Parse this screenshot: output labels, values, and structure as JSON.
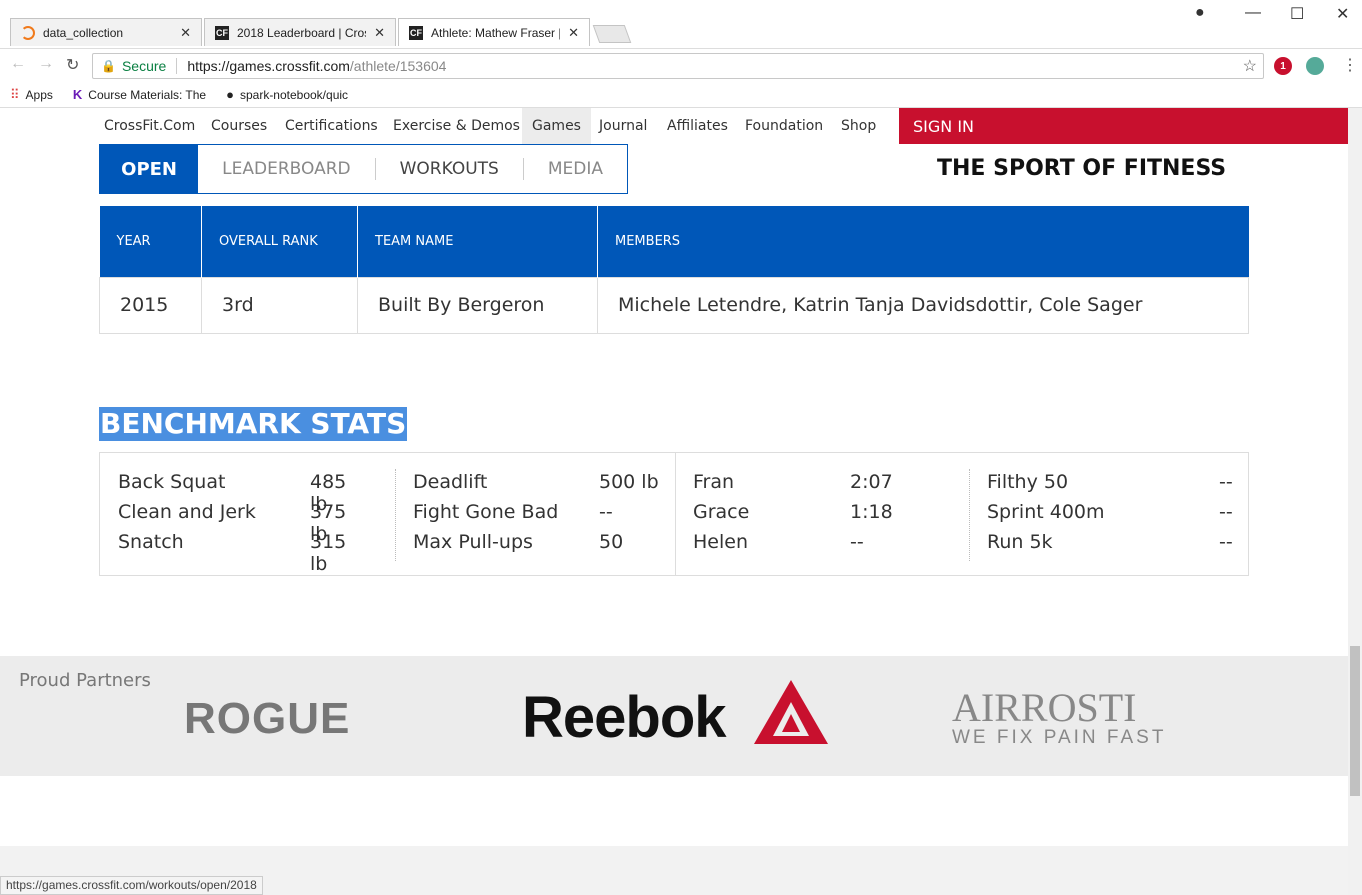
{
  "browser": {
    "tabs": [
      {
        "title": "data_collection",
        "icon": "ring-icon"
      },
      {
        "title": "2018 Leaderboard | Cros",
        "icon": "cf-icon"
      },
      {
        "title": "Athlete: Mathew Fraser |",
        "icon": "cf-icon"
      }
    ],
    "secure_label": "Secure",
    "url_host": "https://games.crossfit.com",
    "url_path": "/athlete/153604",
    "bookmarks": [
      {
        "label": "Apps"
      },
      {
        "label": "Course Materials: The"
      },
      {
        "label": "spark-notebook/quic"
      }
    ],
    "ext_badge": "1",
    "status_url": "https://games.crossfit.com/workouts/open/2018"
  },
  "site_nav": {
    "items": [
      "CrossFit.Com",
      "Courses",
      "Certifications",
      "Exercise & Demos",
      "Games",
      "Journal",
      "Affiliates",
      "Foundation",
      "Shop"
    ],
    "signin": "SIGN IN"
  },
  "sub_nav": {
    "open": "OPEN",
    "items": [
      "LEADERBOARD",
      "WORKOUTS",
      "MEDIA"
    ],
    "slogan": "THE SPORT OF FITNESS"
  },
  "team_table": {
    "headers": [
      "YEAR",
      "OVERALL RANK",
      "TEAM NAME",
      "MEMBERS"
    ],
    "rows": [
      [
        "2015",
        "3rd",
        "Built By Bergeron",
        "Michele Letendre, Katrin Tanja Davidsdottir, Cole Sager"
      ]
    ]
  },
  "benchmark": {
    "title": "BENCHMARK STATS",
    "columns": [
      [
        [
          "Back Squat",
          "485 lb"
        ],
        [
          "Clean and Jerk",
          "375 lb"
        ],
        [
          "Snatch",
          "315 lb"
        ]
      ],
      [
        [
          "Deadlift",
          "500 lb"
        ],
        [
          "Fight Gone Bad",
          "--"
        ],
        [
          "Max Pull-ups",
          "50"
        ]
      ],
      [
        [
          "Fran",
          "2:07"
        ],
        [
          "Grace",
          "1:18"
        ],
        [
          "Helen",
          "--"
        ]
      ],
      [
        [
          "Filthy 50",
          "--"
        ],
        [
          "Sprint 400m",
          "--"
        ],
        [
          "Run 5k",
          "--"
        ]
      ]
    ]
  },
  "partners": {
    "title": "Proud Partners",
    "rogue": "ROGUE",
    "reebok": "Reebok",
    "airrosti_name": "AIRROSTI",
    "airrosti_tagline": "WE FIX PAIN FAST"
  },
  "colors": {
    "brand_blue": "#0057b8",
    "signin_red": "#c8102e"
  }
}
